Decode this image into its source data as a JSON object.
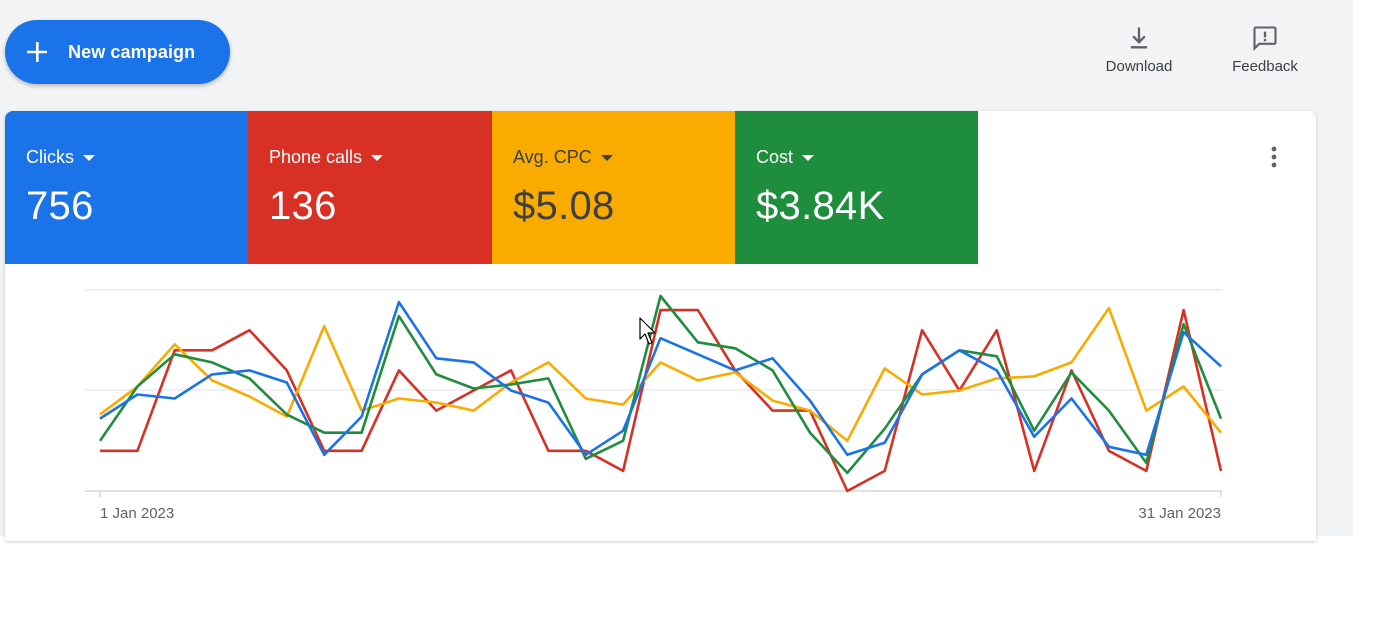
{
  "toolbar": {
    "new_campaign_label": "New campaign",
    "download_label": "Download",
    "feedback_label": "Feedback"
  },
  "metrics": [
    {
      "label": "Clicks",
      "value": "756",
      "color": "#1a73e8"
    },
    {
      "label": "Phone calls",
      "value": "136",
      "color": "#d93025"
    },
    {
      "label": "Avg. CPC",
      "value": "$5.08",
      "color": "#f9ab00"
    },
    {
      "label": "Cost",
      "value": "$3.84K",
      "color": "#1e8e3e"
    }
  ],
  "icons": {
    "new_campaign": "plus-icon",
    "download": "download-icon",
    "feedback": "feedback-icon",
    "more": "more-vert-icon",
    "metric_menu": "caret-down-icon"
  },
  "chart_data": {
    "type": "line",
    "x_labels": [
      "1 Jan 2023",
      "31 Jan 2023"
    ],
    "x_count": 31,
    "ylim": [
      0,
      100
    ],
    "grid": true,
    "series": [
      {
        "metric": "Clicks",
        "color": "#1a73e8",
        "values": [
          36,
          48,
          46,
          58,
          60,
          54,
          18,
          37,
          94,
          66,
          64,
          50,
          44,
          18,
          30,
          76,
          68,
          60,
          66,
          45,
          18,
          24,
          58,
          70,
          60,
          27,
          46,
          22,
          18,
          79,
          62
        ]
      },
      {
        "metric": "Phone calls",
        "color": "#d93025",
        "values": [
          20,
          20,
          70,
          70,
          80,
          60,
          20,
          20,
          60,
          40,
          50,
          60,
          20,
          20,
          10,
          90,
          90,
          60,
          40,
          40,
          0,
          10,
          80,
          50,
          80,
          10,
          60,
          20,
          10,
          90,
          10
        ]
      },
      {
        "metric": "Avg. CPC",
        "color": "#f9ab00",
        "values": [
          38,
          52,
          73,
          55,
          47,
          37,
          82,
          40,
          46,
          44,
          40,
          54,
          64,
          46,
          43,
          64,
          55,
          59,
          45,
          40,
          25,
          61,
          48,
          50,
          56,
          57,
          64,
          91,
          40,
          52,
          29
        ]
      },
      {
        "metric": "Cost",
        "color": "#1e8e3e",
        "values": [
          25,
          52,
          68,
          64,
          56,
          38,
          29,
          29,
          87,
          58,
          51,
          53,
          56,
          16,
          25,
          97,
          74,
          71,
          60,
          29,
          9,
          31,
          58,
          70,
          67,
          30,
          59,
          40,
          14,
          83,
          36
        ]
      }
    ]
  }
}
